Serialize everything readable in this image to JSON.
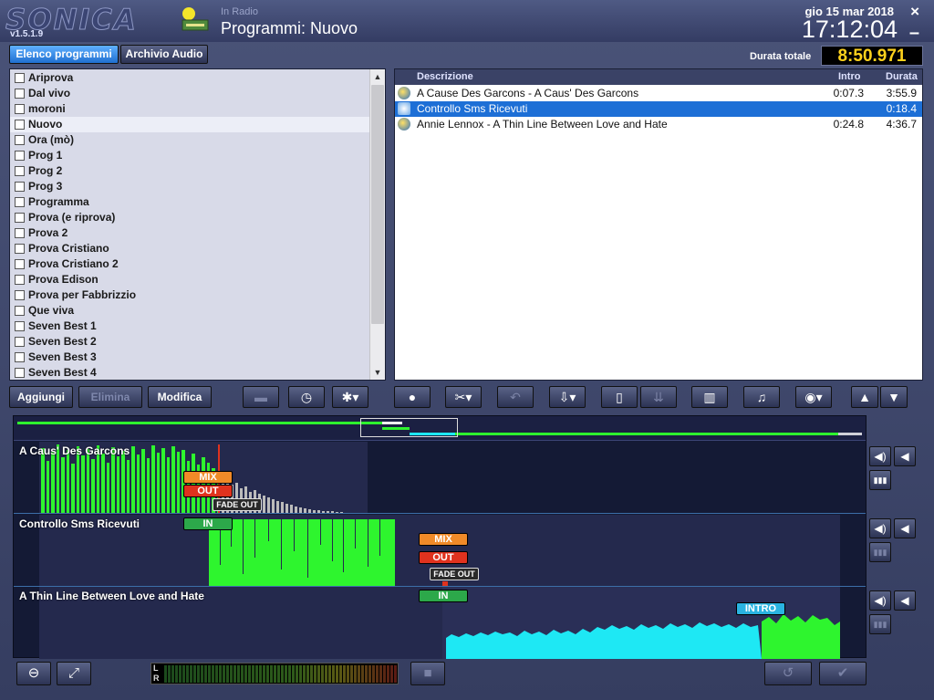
{
  "header": {
    "logo": "SONICA",
    "version": "v1.5.1.9",
    "subtitle": "In Radio",
    "title": "Programmi: Nuovo",
    "date": "gio 15 mar 2018",
    "time": "17:12:04",
    "close_icon": "×",
    "minimize_icon": "–"
  },
  "tabs": [
    {
      "label": "Elenco programmi",
      "active": true
    },
    {
      "label": "Archivio Audio",
      "active": false
    }
  ],
  "total": {
    "label": "Durata totale",
    "value": "8:50.971"
  },
  "programs": [
    {
      "name": "Ariprova"
    },
    {
      "name": "Dal vivo"
    },
    {
      "name": "moroni"
    },
    {
      "name": "Nuovo",
      "selected": true
    },
    {
      "name": "Ora (mò)"
    },
    {
      "name": "Prog 1"
    },
    {
      "name": "Prog 2"
    },
    {
      "name": "Prog 3"
    },
    {
      "name": "Programma"
    },
    {
      "name": "Prova (e riprova)"
    },
    {
      "name": "Prova 2"
    },
    {
      "name": "Prova Cristiano"
    },
    {
      "name": "Prova Cristiano 2"
    },
    {
      "name": "Prova Edison"
    },
    {
      "name": "Prova per Fabbrizzio"
    },
    {
      "name": "Que viva"
    },
    {
      "name": "Seven Best 1"
    },
    {
      "name": "Seven Best 2"
    },
    {
      "name": "Seven Best 3"
    },
    {
      "name": "Seven Best 4"
    }
  ],
  "tracks_table": {
    "headers": {
      "description": "Descrizione",
      "intro": "Intro",
      "duration": "Durata"
    },
    "rows": [
      {
        "description": "A Cause Des Garcons - A Caus' Des Garcons",
        "intro": "0:07.3",
        "duration": "3:55.9",
        "icon": "song-icon",
        "selected": false
      },
      {
        "description": "Controllo Sms Ricevuti",
        "intro": "",
        "duration": "0:18.4",
        "icon": "sms-icon",
        "selected": true
      },
      {
        "description": "Annie Lennox - A Thin Line Between Love and Hate",
        "intro": "0:24.8",
        "duration": "4:36.7",
        "icon": "song-icon",
        "selected": false
      }
    ]
  },
  "toolbar": {
    "add": "Aggiungi",
    "delete": "Elimina",
    "edit": "Modifica",
    "icons": {
      "print": "▬",
      "clock": "◷",
      "settings": "✱▾",
      "comment": "●",
      "tools": "✂▾",
      "undo": "↶",
      "import": "⇩▾",
      "paste": "▯",
      "download": "⇊",
      "trash": "▥",
      "music": "♫",
      "podcast": "◉▾",
      "up": "▲",
      "down": "▼"
    }
  },
  "editor": {
    "tracks": [
      {
        "name": "A Caus' Des Garcons",
        "markers": {
          "mix": "MIX",
          "out": "OUT",
          "fade_out": "FADE OUT"
        }
      },
      {
        "name": "Controllo Sms Ricevuti",
        "markers": {
          "in": "IN",
          "mix": "MIX",
          "out": "OUT",
          "fade_out": "FADE OUT"
        }
      },
      {
        "name": "A Thin Line Between Love and Hate",
        "markers": {
          "in": "IN",
          "intro": "INTRO"
        }
      }
    ],
    "side_icons": {
      "speaker": "◀)",
      "speaker_small": "◀",
      "eq": "▮▮▮"
    }
  },
  "bottom": {
    "zoom_icon": "⊖",
    "fit_icon": "⤢",
    "vu_left": "L",
    "vu_right": "R",
    "stop_icon": "■",
    "revert_icon": "↺",
    "ok_icon": "✔"
  },
  "colors": {
    "accent": "#1d6fd6",
    "wave_green": "#2ef52e",
    "wave_cyan": "#1ee8f4",
    "total_text": "#ffd21c"
  }
}
